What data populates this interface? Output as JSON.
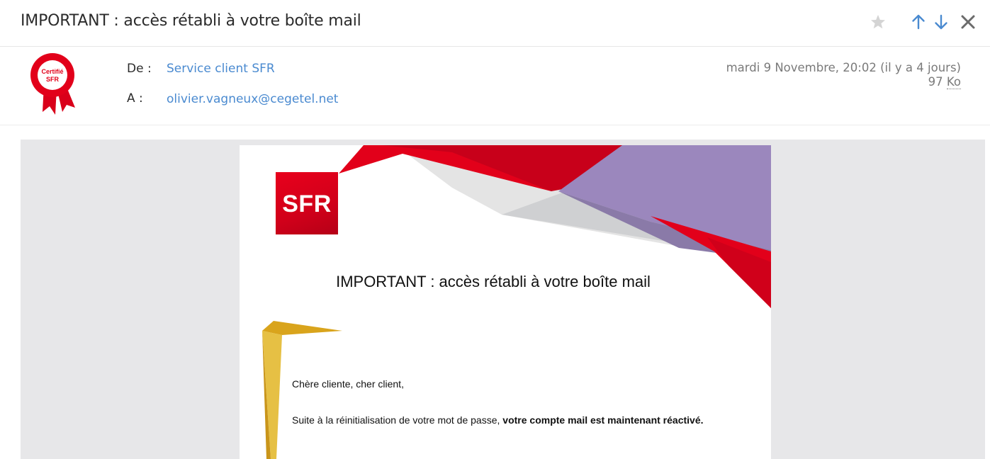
{
  "subject": "IMPORTANT : accès rétabli à votre boîte mail",
  "toolbar": {
    "star_icon": "star-icon",
    "prev_icon": "arrow-up-icon",
    "next_icon": "arrow-down-icon",
    "close_icon": "close-icon"
  },
  "badge": {
    "line1": "Certifié",
    "line2": "SFR"
  },
  "header": {
    "from_label": "De :",
    "from_value": "Service client SFR",
    "to_label": "A :",
    "to_value": "olivier.vagneux@cegetel.net",
    "date": "mardi 9 Novembre, 20:02 (il y a 4 jours)",
    "size_number": "97",
    "size_unit": "Ko"
  },
  "mail": {
    "logo_text": "SFR",
    "title": "IMPORTANT : accès rétabli à votre boîte mail",
    "greeting": "Chère cliente, cher client,",
    "para_normal": "Suite à la réinitialisation de votre mot de passe, ",
    "para_bold": "votre compte mail est maintenant réactivé."
  },
  "colors": {
    "link": "#4a8ad0",
    "sfr_red": "#e2001a",
    "purple": "#9b87bd",
    "gold": "#e0b120"
  }
}
